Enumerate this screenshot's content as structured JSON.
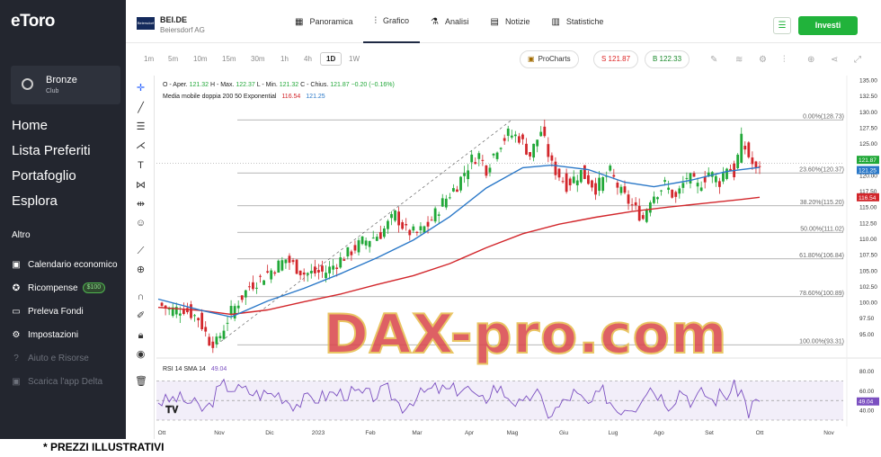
{
  "sidebar": {
    "brand": "eToro",
    "club_name": "Bronze",
    "club_sub": "Club",
    "main_nav": [
      "Home",
      "Lista Preferiti",
      "Portafoglio",
      "Esplora"
    ],
    "section_title": "Altro",
    "sub_nav": [
      {
        "label": "Calendario economico",
        "icon": "calendar-icon",
        "glyph": "▣"
      },
      {
        "label": "Ricompense",
        "icon": "rewards-icon",
        "glyph": "✪",
        "badge": "$100"
      },
      {
        "label": "Preleva Fondi",
        "icon": "withdraw-icon",
        "glyph": "▭"
      },
      {
        "label": "Impostazioni",
        "icon": "settings-icon",
        "glyph": "⚙"
      },
      {
        "label": "Aiuto e Risorse",
        "icon": "help-icon",
        "glyph": "?"
      },
      {
        "label": "Scarica l'app Delta",
        "icon": "download-icon",
        "glyph": "▣"
      }
    ]
  },
  "instrument": {
    "ticker": "BEI.DE",
    "company": "Beiersdorf AG",
    "logo_text": "Beiersdorf"
  },
  "tabs": [
    {
      "label": "Panoramica",
      "icon": "grid-icon",
      "glyph": "▦"
    },
    {
      "label": "Grafico",
      "icon": "candles-icon",
      "glyph": "⫶"
    },
    {
      "label": "Analisi",
      "icon": "flask-icon",
      "glyph": "⚗"
    },
    {
      "label": "Notizie",
      "icon": "news-icon",
      "glyph": "▤"
    },
    {
      "label": "Statistiche",
      "icon": "stats-icon",
      "glyph": "▥"
    }
  ],
  "active_tab": "Grafico",
  "invest_label": "Investi",
  "timeframes": [
    "1m",
    "5m",
    "10m",
    "15m",
    "30m",
    "1h",
    "4h",
    "1D",
    "1W"
  ],
  "active_timeframe": "1D",
  "procharts_label": "ProCharts",
  "sell_label": "S 121.87",
  "buy_label": "B 122.33",
  "ohlc": {
    "open_label": "O - Aper.",
    "open": "121.32",
    "high_label": "H - Max.",
    "high": "122.37",
    "low_label": "L - Min.",
    "low": "121.32",
    "close_label": "C - Chius.",
    "close": "121.87",
    "change": "−0.20 (−0.16%)"
  },
  "ma_label": "Media mobile doppia 200 50 Exponential",
  "ma_values": [
    "116.54",
    "121.25"
  ],
  "rsi_label": "RSI 14 SMA 14",
  "rsi_value": "49.04",
  "watermark": "DAX-pro.com",
  "footnote": "* PREZZI ILLUSTRATIVI",
  "colors": {
    "up": "#21a838",
    "down": "#d2262b",
    "ema50": "#2a78c8",
    "ema200": "#d2262b",
    "rsi": "#7b4fc0",
    "invest": "#21b33b"
  },
  "chart_data": {
    "type": "candlestick",
    "price_axis": {
      "min": 92.5,
      "max": 135.0,
      "ticks": [
        "135.00",
        "132.50",
        "130.00",
        "127.50",
        "125.00",
        "122.50",
        "120.00",
        "117.50",
        "115.00",
        "112.50",
        "110.00",
        "107.50",
        "105.00",
        "102.50",
        "100.00",
        "97.50",
        "95.00"
      ]
    },
    "x_labels": [
      "Ott",
      "Nov",
      "Dic",
      "2023",
      "Feb",
      "Mar",
      "Apr",
      "Mag",
      "Giu",
      "Lug",
      "Ago",
      "Set",
      "Ott",
      "Nov"
    ],
    "fibonacci": [
      {
        "label": "0.00%(128.73)",
        "value": 128.73
      },
      {
        "label": "23.60%(120.37)",
        "value": 120.37
      },
      {
        "label": "38.20%(115.20)",
        "value": 115.2
      },
      {
        "label": "50.00%(111.02)",
        "value": 111.02
      },
      {
        "label": "61.80%(106.84)",
        "value": 106.84
      },
      {
        "label": "78.60%(100.89)",
        "value": 100.89
      },
      {
        "label": "100.00%(93.31)",
        "value": 93.31
      }
    ],
    "price_tags": [
      {
        "value": "121.87",
        "color": "#21a838"
      },
      {
        "value": "121.25",
        "color": "#2a78c8"
      },
      {
        "value": "116.54",
        "color": "#d2262b"
      }
    ],
    "close_path": [
      {
        "t": 0,
        "v": 99.8
      },
      {
        "t": 3,
        "v": 98.8
      },
      {
        "t": 7,
        "v": 99.0
      },
      {
        "t": 11,
        "v": 97.5
      },
      {
        "t": 14,
        "v": 94.0
      },
      {
        "t": 16,
        "v": 93.6
      },
      {
        "t": 20,
        "v": 98.5
      },
      {
        "t": 25,
        "v": 102.5
      },
      {
        "t": 30,
        "v": 104.6
      },
      {
        "t": 35,
        "v": 106.8
      },
      {
        "t": 40,
        "v": 104.5
      },
      {
        "t": 46,
        "v": 104.8
      },
      {
        "t": 51,
        "v": 107.2
      },
      {
        "t": 56,
        "v": 109.5
      },
      {
        "t": 61,
        "v": 110.8
      },
      {
        "t": 65,
        "v": 113.8
      },
      {
        "t": 68,
        "v": 111.2
      },
      {
        "t": 71,
        "v": 110.8
      },
      {
        "t": 74,
        "v": 112.2
      },
      {
        "t": 78,
        "v": 115.7
      },
      {
        "t": 82,
        "v": 118.5
      },
      {
        "t": 86,
        "v": 122.5
      },
      {
        "t": 88,
        "v": 123.2
      },
      {
        "t": 90,
        "v": 121.0
      },
      {
        "t": 93,
        "v": 124.5
      },
      {
        "t": 96,
        "v": 126.5
      },
      {
        "t": 99,
        "v": 126.0
      },
      {
        "t": 102,
        "v": 123.2
      },
      {
        "t": 105,
        "v": 127.0
      },
      {
        "t": 108,
        "v": 121.5
      },
      {
        "t": 112,
        "v": 118.5
      },
      {
        "t": 116,
        "v": 120.5
      },
      {
        "t": 120,
        "v": 118.0
      },
      {
        "t": 124,
        "v": 120.5
      },
      {
        "t": 127,
        "v": 117.2
      },
      {
        "t": 130,
        "v": 115.2
      },
      {
        "t": 133,
        "v": 113.2
      },
      {
        "t": 135,
        "v": 116.5
      },
      {
        "t": 139,
        "v": 118.5
      },
      {
        "t": 142,
        "v": 116.3
      },
      {
        "t": 145,
        "v": 119.8
      },
      {
        "t": 148,
        "v": 118.2
      },
      {
        "t": 151,
        "v": 120.5
      },
      {
        "t": 154,
        "v": 119.0
      },
      {
        "t": 156,
        "v": 121.5
      },
      {
        "t": 158,
        "v": 120.3
      },
      {
        "t": 160,
        "v": 125.5
      },
      {
        "t": 162,
        "v": 123.0
      },
      {
        "t": 164,
        "v": 120.5
      },
      {
        "t": 165,
        "v": 121.87
      }
    ],
    "ema50": [
      {
        "t": 0,
        "v": 100.5
      },
      {
        "t": 12,
        "v": 98.7
      },
      {
        "t": 20,
        "v": 97.7
      },
      {
        "t": 30,
        "v": 100.2
      },
      {
        "t": 40,
        "v": 102.2
      },
      {
        "t": 50,
        "v": 104.5
      },
      {
        "t": 60,
        "v": 107.0
      },
      {
        "t": 70,
        "v": 109.8
      },
      {
        "t": 80,
        "v": 113.5
      },
      {
        "t": 90,
        "v": 118.0
      },
      {
        "t": 100,
        "v": 121.2
      },
      {
        "t": 108,
        "v": 121.6
      },
      {
        "t": 118,
        "v": 120.9
      },
      {
        "t": 128,
        "v": 118.9
      },
      {
        "t": 136,
        "v": 118.2
      },
      {
        "t": 146,
        "v": 119.2
      },
      {
        "t": 156,
        "v": 120.6
      },
      {
        "t": 165,
        "v": 121.25
      }
    ],
    "ema200": [
      {
        "t": 0,
        "v": 99.2
      },
      {
        "t": 12,
        "v": 98.7
      },
      {
        "t": 20,
        "v": 98.1
      },
      {
        "t": 30,
        "v": 98.8
      },
      {
        "t": 40,
        "v": 100.1
      },
      {
        "t": 50,
        "v": 101.3
      },
      {
        "t": 60,
        "v": 102.8
      },
      {
        "t": 70,
        "v": 104.2
      },
      {
        "t": 80,
        "v": 106.1
      },
      {
        "t": 90,
        "v": 108.6
      },
      {
        "t": 100,
        "v": 110.8
      },
      {
        "t": 110,
        "v": 112.3
      },
      {
        "t": 120,
        "v": 113.4
      },
      {
        "t": 130,
        "v": 114.3
      },
      {
        "t": 140,
        "v": 115.0
      },
      {
        "t": 150,
        "v": 115.6
      },
      {
        "t": 160,
        "v": 116.2
      },
      {
        "t": 165,
        "v": 116.54
      }
    ],
    "rsi": {
      "range": [
        30,
        85
      ],
      "ticks": [
        "80.00",
        "60.00",
        "40.00"
      ],
      "bands": [
        30,
        70
      ],
      "last": "49.04"
    }
  }
}
